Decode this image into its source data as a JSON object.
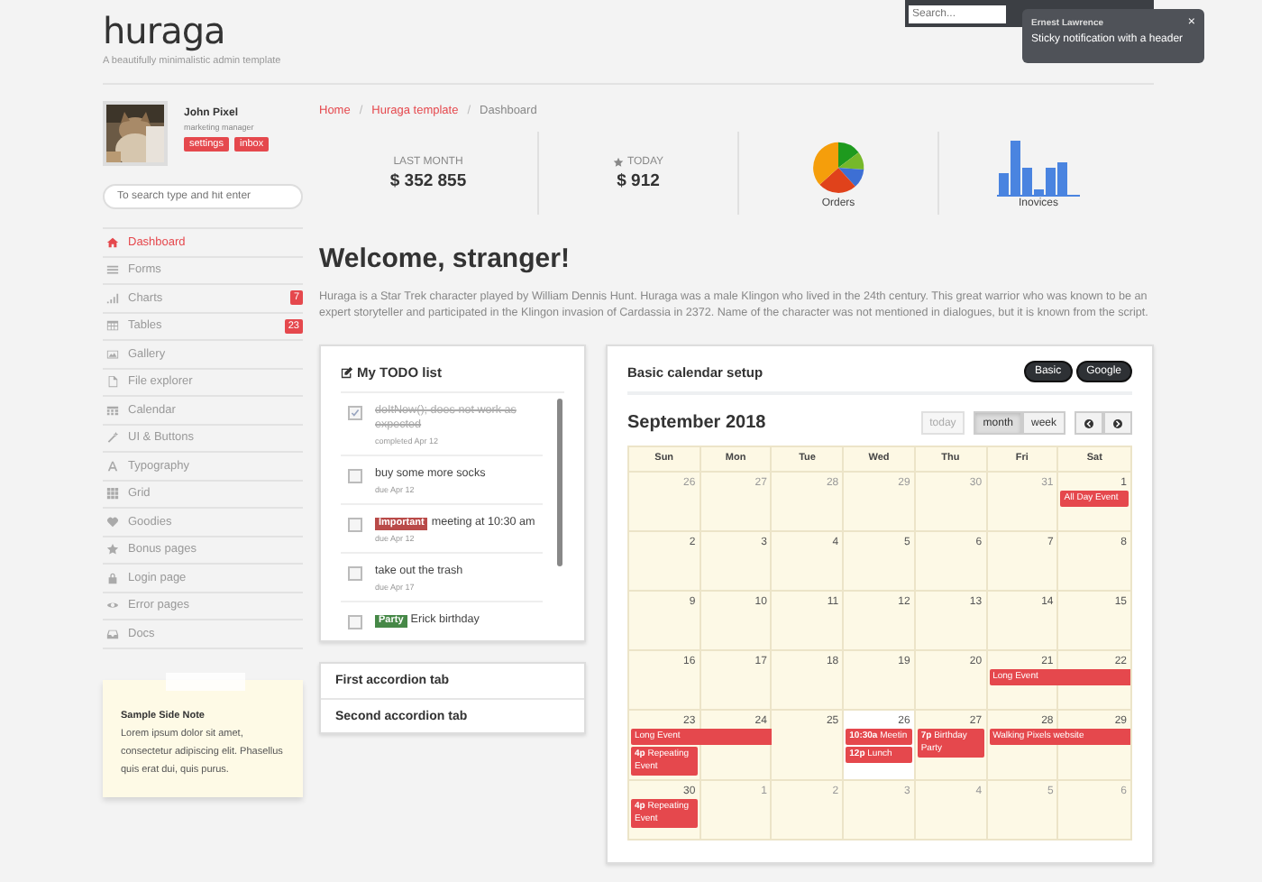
{
  "header": {
    "logo": "huraga",
    "tagline": "A beautifully minimalistic admin template"
  },
  "topbar": {
    "search": {
      "placeholder": "Search..."
    }
  },
  "notification": {
    "title": "Ernest Lawrence",
    "message": "Sticky notification with a header",
    "close": "×"
  },
  "profile": {
    "name": "John Pixel",
    "role": "marketing manager",
    "buttons": [
      "settings",
      "inbox"
    ]
  },
  "sidebar": {
    "search": {
      "placeholder": "To search type and hit enter"
    },
    "items": [
      {
        "label": "Dashboard",
        "selected": true
      },
      {
        "label": "Forms",
        "selected": false
      },
      {
        "label": "Charts",
        "selected": false,
        "count": "7"
      },
      {
        "label": "Tables",
        "selected": false,
        "count": "23"
      },
      {
        "label": "Gallery",
        "selected": false
      },
      {
        "label": "File explorer",
        "selected": false
      },
      {
        "label": "Calendar",
        "selected": false
      },
      {
        "label": "UI & Buttons",
        "selected": false
      },
      {
        "label": "Typography",
        "selected": false
      },
      {
        "label": "Grid",
        "selected": false
      },
      {
        "label": "Goodies",
        "selected": false
      },
      {
        "label": "Bonus pages",
        "selected": false
      },
      {
        "label": "Login page",
        "selected": false
      },
      {
        "label": "Error pages",
        "selected": false
      },
      {
        "label": "Docs",
        "selected": false
      }
    ]
  },
  "side_note": {
    "title": "Sample Side Note",
    "text": "Lorem ipsum dolor sit amet, consectetur adipiscing elit. Phasellus quis erat dui, quis purus."
  },
  "breadcrumbs": {
    "separator": "/",
    "items": [
      {
        "label": "Home",
        "link": true
      },
      {
        "label": "Huraga template",
        "link": true
      },
      {
        "label": "Dashboard",
        "link": false
      }
    ]
  },
  "stats": [
    {
      "kind": "figure",
      "label": "LAST MONTH",
      "value": "$ 352 855"
    },
    {
      "kind": "figure",
      "label": "TODAY",
      "value": "$ 912",
      "starred": true
    },
    {
      "kind": "pie",
      "label": "Orders"
    },
    {
      "kind": "bars",
      "label": "Inovices"
    }
  ],
  "welcome": {
    "title": "Welcome, stranger!",
    "text": "Huraga is a Star Trek character played by William Dennis Hunt. Huraga was a male Klingon who lived in the 24th century. This great warrior who was known to be an expert storyteller and participated in the Klingon invasion of Cardassia in 2372. Name of the character was not mentioned in dialogues, but it is known from the script."
  },
  "todo": {
    "title": "My TODO list",
    "items": [
      {
        "text": "doItNow(); does not work as expected",
        "note": "completed Apr 12",
        "checked": true
      },
      {
        "text": "buy some more socks",
        "note": "due Apr 12",
        "checked": false
      },
      {
        "tag": {
          "label": "Important",
          "color": "#b94a48"
        },
        "text": "meeting at 10:30 am",
        "note": "due Apr 12",
        "checked": false
      },
      {
        "text": "take out the trash",
        "note": "due Apr 17",
        "checked": false
      },
      {
        "tag": {
          "label": "Party",
          "color": "#468847"
        },
        "text": "Erick birthday",
        "checked": false
      }
    ]
  },
  "accordion": [
    {
      "title": "First accordion tab"
    },
    {
      "title": "Second accordion tab"
    }
  ],
  "calendar": {
    "title": "Basic calendar setup",
    "sources": [
      {
        "label": "Basic"
      },
      {
        "label": "Google"
      }
    ],
    "month": "September 2018",
    "today_button": {
      "label": "today",
      "disabled": true
    },
    "views": [
      {
        "label": "month",
        "selected": true
      },
      {
        "label": "week",
        "selected": false
      }
    ],
    "weekdays": [
      "Sun",
      "Mon",
      "Tue",
      "Wed",
      "Thu",
      "Fri",
      "Sat"
    ],
    "weeks": [
      {
        "days": [
          {
            "date": "26",
            "other_month": true
          },
          {
            "date": "27",
            "other_month": true
          },
          {
            "date": "28",
            "other_month": true
          },
          {
            "date": "29",
            "other_month": true
          },
          {
            "date": "30",
            "other_month": true
          },
          {
            "date": "31",
            "other_month": true
          },
          {
            "date": "1",
            "other_month": false,
            "events": [
              {
                "title": "All Day Event",
                "continues": false
              }
            ]
          }
        ]
      },
      {
        "days": [
          {
            "date": "2",
            "other_month": false
          },
          {
            "date": "3",
            "other_month": false
          },
          {
            "date": "4",
            "other_month": false
          },
          {
            "date": "5",
            "other_month": false
          },
          {
            "date": "6",
            "other_month": false
          },
          {
            "date": "7",
            "other_month": false
          },
          {
            "date": "8",
            "other_month": false
          }
        ]
      },
      {
        "days": [
          {
            "date": "9",
            "other_month": false
          },
          {
            "date": "10",
            "other_month": false
          },
          {
            "date": "11",
            "other_month": false
          },
          {
            "date": "12",
            "other_month": false
          },
          {
            "date": "13",
            "other_month": false
          },
          {
            "date": "14",
            "other_month": false
          },
          {
            "date": "15",
            "other_month": false
          }
        ]
      },
      {
        "days": [
          {
            "date": "16",
            "other_month": false
          },
          {
            "date": "17",
            "other_month": false
          },
          {
            "date": "18",
            "other_month": false
          },
          {
            "date": "19",
            "other_month": false
          },
          {
            "date": "20",
            "other_month": false
          },
          {
            "date": "21",
            "other_month": false,
            "events": [
              {
                "title": "Long Event",
                "continues": true
              }
            ]
          },
          {
            "date": "22",
            "other_month": false
          }
        ]
      },
      {
        "days": [
          {
            "date": "23",
            "other_month": false,
            "events": [
              {
                "title": "Long Event",
                "continues": true
              },
              {
                "time": "4p",
                "title": "Repeating Event",
                "continues": false
              }
            ]
          },
          {
            "date": "24",
            "other_month": false
          },
          {
            "date": "25",
            "other_month": false
          },
          {
            "date": "26",
            "other_month": false,
            "today": true,
            "events": [
              {
                "time": "10:30a",
                "title": "Meetin",
                "continues": false
              },
              {
                "time": "12p",
                "title": "Lunch",
                "continues": false
              }
            ]
          },
          {
            "date": "27",
            "other_month": false,
            "events": [
              {
                "time": "7p",
                "title": "Birthday Party",
                "continues": false
              }
            ]
          },
          {
            "date": "28",
            "other_month": false,
            "events": [
              {
                "title": "Walking Pixels website",
                "continues": true
              }
            ]
          },
          {
            "date": "29",
            "other_month": false
          }
        ]
      },
      {
        "days": [
          {
            "date": "30",
            "other_month": false,
            "events": [
              {
                "time": "4p",
                "title": "Repeating Event",
                "continues": false
              }
            ]
          },
          {
            "date": "1",
            "other_month": true
          },
          {
            "date": "2",
            "other_month": true
          },
          {
            "date": "3",
            "other_month": true
          },
          {
            "date": "4",
            "other_month": true
          },
          {
            "date": "5",
            "other_month": true
          },
          {
            "date": "6",
            "other_month": true
          }
        ]
      }
    ]
  }
}
